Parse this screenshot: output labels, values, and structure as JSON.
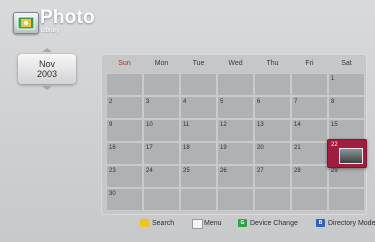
{
  "header": {
    "title": "Photo",
    "subtitle": "Library",
    "app_icon": "photo-library-icon"
  },
  "month_picker": {
    "month": "Nov",
    "year": "2003"
  },
  "calendar": {
    "weekdays": [
      "Sun",
      "Mon",
      "Tue",
      "Wed",
      "Thu",
      "Fri",
      "Sat"
    ],
    "weekday_colors": {
      "Sun": "#d41e2c",
      "default": "#3a3a3a"
    },
    "weeks": [
      [
        "",
        "",
        "",
        "",
        "",
        "",
        "1"
      ],
      [
        "2",
        "3",
        "4",
        "5",
        "6",
        "7",
        "8"
      ],
      [
        "9",
        "10",
        "11",
        "12",
        "13",
        "14",
        "15"
      ],
      [
        "16",
        "17",
        "18",
        "19",
        "20",
        "21",
        "22"
      ],
      [
        "23",
        "24",
        "25",
        "26",
        "27",
        "28",
        "29"
      ],
      [
        "30",
        "",
        "",
        "",
        "",
        "",
        ""
      ]
    ],
    "selected_day": "22",
    "selected_color": "#a01d3f"
  },
  "legend": [
    {
      "key_color": "#f2c31b",
      "key_glyph": "",
      "label": "Search"
    },
    {
      "key_color": "#f4f4f4",
      "key_glyph": "",
      "label": "Menu"
    },
    {
      "key_color": "#2fa24a",
      "key_glyph": "G",
      "label": "Device Change"
    },
    {
      "key_color": "#2f5fbf",
      "key_glyph": "B",
      "label": "Directory Mode"
    }
  ]
}
